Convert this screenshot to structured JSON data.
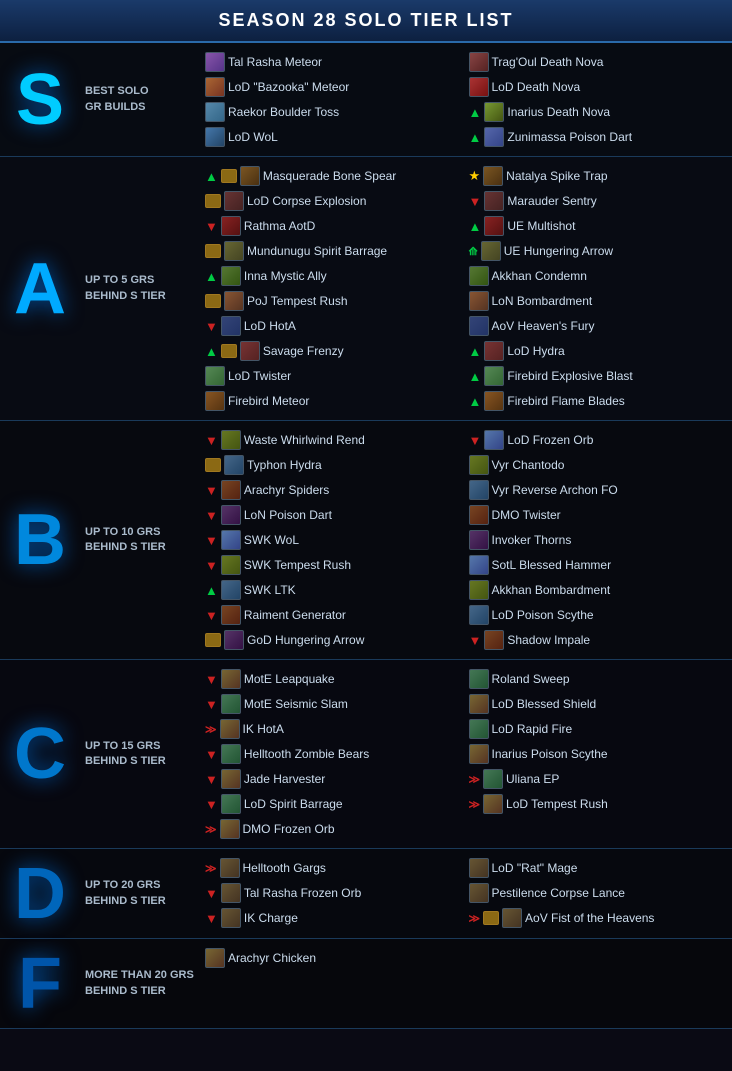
{
  "header": {
    "title": "SEASON 28 SOLO TIER LIST"
  },
  "tiers": [
    {
      "id": "s",
      "letter": "S",
      "desc": "BEST SOLO\nGR BUILDS",
      "left": [
        {
          "name": "Tal Rasha Meteor",
          "avatar": "s1",
          "arrowUp": false,
          "arrowDown": false,
          "bag": false,
          "gem": false
        },
        {
          "name": "LoD \"Bazooka\" Meteor",
          "avatar": "s2",
          "arrowUp": false,
          "arrowDown": false,
          "bag": false,
          "gem": false
        },
        {
          "name": "Raekor Boulder Toss",
          "avatar": "s3",
          "arrowUp": false,
          "arrowDown": false,
          "bag": false,
          "gem": false
        },
        {
          "name": "LoD WoL",
          "avatar": "s4",
          "arrowUp": false,
          "arrowDown": false,
          "bag": false,
          "gem": false
        }
      ],
      "right": [
        {
          "name": "Trag'Oul Death Nova",
          "avatar": "s5",
          "arrowUp": false,
          "arrowDown": false,
          "bag": false,
          "gem": false
        },
        {
          "name": "LoD Death Nova",
          "avatar": "s6",
          "arrowUp": false,
          "arrowDown": false,
          "bag": false,
          "gem": false
        },
        {
          "name": "Inarius Death Nova",
          "avatar": "s7",
          "arrowUp": true,
          "arrowDown": false,
          "bag": false,
          "gem": false
        },
        {
          "name": "Zunimassa Poison Dart",
          "avatar": "s8",
          "arrowUp": true,
          "arrowDown": false,
          "bag": false,
          "gem": false
        }
      ]
    },
    {
      "id": "a",
      "letter": "A",
      "desc": "UP TO 5 GRS\nBEHIND S TIER",
      "left": [
        {
          "name": "Masquerade Bone Spear",
          "avatar": "a1",
          "arrowUp": true,
          "arrowDown": false,
          "bag": true,
          "gem": false
        },
        {
          "name": "LoD Corpse Explosion",
          "avatar": "a2",
          "arrowUp": false,
          "arrowDown": false,
          "bag": true,
          "gem": false
        },
        {
          "name": "Rathma AotD",
          "avatar": "a3",
          "arrowUp": false,
          "arrowDown": true,
          "bag": false,
          "gem": false
        },
        {
          "name": "Mundunugu Spirit Barrage",
          "avatar": "a4",
          "arrowUp": false,
          "arrowDown": false,
          "bag": true,
          "gem": false
        },
        {
          "name": "Inna Mystic Ally",
          "avatar": "a5",
          "arrowUp": true,
          "arrowDown": false,
          "bag": false,
          "gem": false
        },
        {
          "name": "PoJ Tempest Rush",
          "avatar": "a6",
          "arrowUp": false,
          "arrowDown": false,
          "bag": true,
          "gem": false
        },
        {
          "name": "LoD HotA",
          "avatar": "a7",
          "arrowUp": false,
          "arrowDown": true,
          "bag": false,
          "gem": false
        },
        {
          "name": "Savage Frenzy",
          "avatar": "a8",
          "arrowUp": true,
          "arrowDown": false,
          "bag": true,
          "gem": false
        },
        {
          "name": "LoD Twister",
          "avatar": "a9",
          "arrowUp": false,
          "arrowDown": false,
          "bag": false,
          "gem": false
        },
        {
          "name": "Firebird Meteor",
          "avatar": "a10",
          "arrowUp": false,
          "arrowDown": false,
          "bag": false,
          "gem": false
        }
      ],
      "right": [
        {
          "name": "Natalya Spike Trap",
          "avatar": "a1",
          "arrowUp": false,
          "arrowDown": false,
          "star": true
        },
        {
          "name": "Marauder Sentry",
          "avatar": "a2",
          "arrowUp": false,
          "arrowDown": true,
          "bag": false
        },
        {
          "name": "UE Multishot",
          "avatar": "a3",
          "arrowUp": true,
          "arrowDown": false,
          "bag": false
        },
        {
          "name": "UE Hungering Arrow",
          "avatar": "a4",
          "arrowUp": true,
          "arrowDown": false,
          "arrowDouble": true
        },
        {
          "name": "Akkhan Condemn",
          "avatar": "a5",
          "arrowUp": false,
          "arrowDown": false,
          "bag": false
        },
        {
          "name": "LoN Bombardment",
          "avatar": "a6",
          "arrowUp": false,
          "arrowDown": false,
          "bag": false
        },
        {
          "name": "AoV Heaven's Fury",
          "avatar": "a7",
          "arrowUp": false,
          "arrowDown": false,
          "bag": false
        },
        {
          "name": "LoD Hydra",
          "avatar": "a8",
          "arrowUp": true,
          "arrowDown": false,
          "bag": false
        },
        {
          "name": "Firebird Explosive Blast",
          "avatar": "a9",
          "arrowUp": true,
          "arrowDown": false,
          "bag": false
        },
        {
          "name": "Firebird Flame Blades",
          "avatar": "a10",
          "arrowUp": true,
          "arrowDown": false,
          "bag": false
        }
      ]
    },
    {
      "id": "b",
      "letter": "B",
      "desc": "UP TO 10 GRS\nBEHIND S TIER",
      "left": [
        {
          "name": "Waste Whirlwind Rend",
          "avatar": "b1",
          "arrowDown": true
        },
        {
          "name": "Typhon Hydra",
          "avatar": "b2",
          "bag": true
        },
        {
          "name": "Arachyr Spiders",
          "avatar": "b3",
          "arrowDown": true
        },
        {
          "name": "LoN Poison Dart",
          "avatar": "b4",
          "arrowDown": true
        },
        {
          "name": "SWK WoL",
          "avatar": "b5",
          "arrowDown": true
        },
        {
          "name": "SWK Tempest Rush",
          "avatar": "b1",
          "arrowDown": true
        },
        {
          "name": "SWK LTK",
          "avatar": "b2",
          "arrowUp": true
        },
        {
          "name": "Raiment Generator",
          "avatar": "b3",
          "arrowDown": true
        },
        {
          "name": "GoD Hungering Arrow",
          "avatar": "b4",
          "bag": true
        }
      ],
      "right": [
        {
          "name": "LoD Frozen Orb",
          "avatar": "b5",
          "arrowDown": true
        },
        {
          "name": "Vyr Chantodo",
          "avatar": "b1"
        },
        {
          "name": "Vyr Reverse Archon FO",
          "avatar": "b2"
        },
        {
          "name": "DMO Twister",
          "avatar": "b3"
        },
        {
          "name": "Invoker Thorns",
          "avatar": "b4"
        },
        {
          "name": "SotL Blessed Hammer",
          "avatar": "b5"
        },
        {
          "name": "Akkhan Bombardment",
          "avatar": "b1"
        },
        {
          "name": "LoD Poison Scythe",
          "avatar": "b2",
          "avatar2": true
        },
        {
          "name": "Shadow Impale",
          "avatar": "b3",
          "arrowDown": true
        }
      ]
    },
    {
      "id": "c",
      "letter": "C",
      "desc": "UP TO 15 GRS\nBEHIND S TIER",
      "left": [
        {
          "name": "MotE Leapquake",
          "avatar": "c1",
          "arrowDown": true
        },
        {
          "name": "MotE Seismic Slam",
          "avatar": "c2",
          "arrowDown": true
        },
        {
          "name": "IK HotA",
          "avatar": "c1",
          "arrowDoubleDown": true
        },
        {
          "name": "Helltooth Zombie Bears",
          "avatar": "c2",
          "arrowDown": true
        },
        {
          "name": "Jade Harvester",
          "avatar": "c1",
          "arrowDown": true
        },
        {
          "name": "LoD Spirit Barrage",
          "avatar": "c2",
          "arrowDown": true
        },
        {
          "name": "DMO Frozen Orb",
          "avatar": "c1",
          "arrowDoubleDown": true
        }
      ],
      "right": [
        {
          "name": "Roland Sweep",
          "avatar": "c2"
        },
        {
          "name": "LoD Blessed Shield",
          "avatar": "c1"
        },
        {
          "name": "LoD Rapid Fire",
          "avatar": "c2"
        },
        {
          "name": "Inarius Poison Scythe",
          "avatar": "c1"
        },
        {
          "name": "Uliana EP",
          "avatar": "c2",
          "arrowDoubleDown": true
        },
        {
          "name": "LoD Tempest Rush",
          "avatar": "c1",
          "arrowDoubleDown": true
        }
      ]
    },
    {
      "id": "d",
      "letter": "D",
      "desc": "UP TO 20 GRS\nBEHIND S TIER",
      "left": [
        {
          "name": "Helltooth Gargs",
          "avatar": "d1",
          "arrowDoubleDown": true
        },
        {
          "name": "Tal Rasha Frozen Orb",
          "avatar": "d1",
          "arrowDown": true
        },
        {
          "name": "IK Charge",
          "avatar": "d1",
          "arrowDown": true
        }
      ],
      "right": [
        {
          "name": "LoD \"Rat\" Mage",
          "avatar": "d1"
        },
        {
          "name": "Pestilence Corpse Lance",
          "avatar": "d1"
        },
        {
          "name": "AoV Fist of the Heavens",
          "avatar": "d1",
          "bag": true,
          "arrowDoubleDown": true
        }
      ]
    },
    {
      "id": "f",
      "letter": "F",
      "desc": "MORE THAN 20 GRS\nBEHIND S TIER",
      "left": [
        {
          "name": "Arachyr Chicken",
          "avatar": "c1"
        }
      ],
      "right": []
    }
  ]
}
